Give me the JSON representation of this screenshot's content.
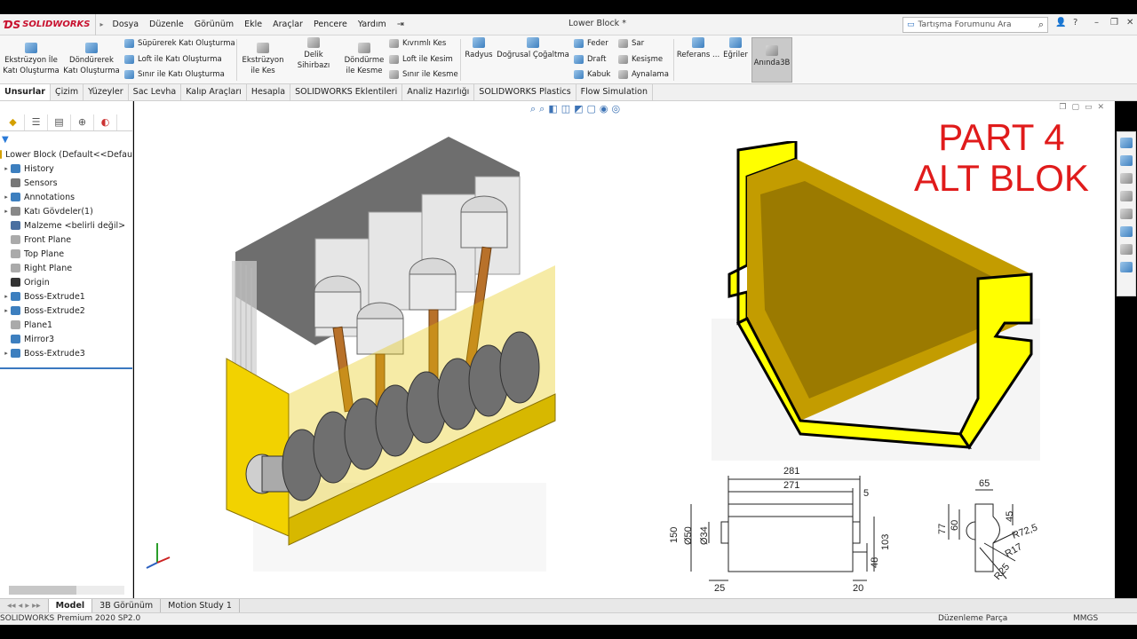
{
  "app": {
    "brand": "SOLIDWORKS",
    "document_title": "Lower Block *",
    "menu": [
      "Dosya",
      "Düzenle",
      "Görünüm",
      "Ekle",
      "Araçlar",
      "Pencere",
      "Yardım"
    ],
    "search_placeholder": "Tartışma Forumunu Ara"
  },
  "ribbon": {
    "extrude_boss": "Ekstrüzyon İle\nKatı Oluşturma",
    "revolve_boss": "Döndürerek\nKatı Oluşturma",
    "sweep_boss": "Süpürerek Katı Oluşturma",
    "loft_boss": "Loft ile Katı Oluşturma",
    "boundary_boss": "Sınır ile Katı Oluşturma",
    "extrude_cut": "Ekstrüzyon\nile Kes",
    "hole_wizard": "Delik Sihirbazı",
    "revolve_cut": "Döndürme\nile Kesme",
    "sweep_cut": "Kıvrımlı Kes",
    "loft_cut": "Loft ile Kesim",
    "boundary_cut": "Sınır ile Kesme",
    "fillet": "Radyus",
    "linear_pattern": "Doğrusal Çoğaltma",
    "rib": "Feder",
    "draft": "Draft",
    "shell": "Kabuk",
    "wrap": "Sar",
    "intersect": "Kesişme",
    "mirror": "Aynalama",
    "reference": "Referans ...",
    "curves": "Eğriler",
    "instant3d": "Anında3B"
  },
  "tabs": [
    "Unsurlar",
    "Çizim",
    "Yüzeyler",
    "Sac Levha",
    "Kalıp Araçları",
    "Hesapla",
    "SOLIDWORKS Eklentileri",
    "Analiz Hazırlığı",
    "SOLIDWORKS Plastics",
    "Flow Simulation"
  ],
  "tree": {
    "items": [
      {
        "label": "Lower Block  (Default<<Defau",
        "icon": "part-icon",
        "expand": "",
        "indent": 0
      },
      {
        "label": "History",
        "icon": "history-icon",
        "expand": "▸",
        "indent": 1
      },
      {
        "label": "Sensors",
        "icon": "sensors-icon",
        "expand": "",
        "indent": 1
      },
      {
        "label": "Annotations",
        "icon": "annotations-icon",
        "expand": "▸",
        "indent": 1
      },
      {
        "label": "Katı Gövdeler(1)",
        "icon": "solid-bodies-icon",
        "expand": "▸",
        "indent": 1
      },
      {
        "label": "Malzeme <belirli değil>",
        "icon": "material-icon",
        "expand": "",
        "indent": 1
      },
      {
        "label": "Front Plane",
        "icon": "plane-icon",
        "expand": "",
        "indent": 1
      },
      {
        "label": "Top Plane",
        "icon": "plane-icon",
        "expand": "",
        "indent": 1
      },
      {
        "label": "Right Plane",
        "icon": "plane-icon",
        "expand": "",
        "indent": 1
      },
      {
        "label": "Origin",
        "icon": "origin-icon",
        "expand": "",
        "indent": 1
      },
      {
        "label": "Boss-Extrude1",
        "icon": "extrude-icon",
        "expand": "▸",
        "indent": 1
      },
      {
        "label": "Boss-Extrude2",
        "icon": "extrude-icon",
        "expand": "▸",
        "indent": 1
      },
      {
        "label": "Plane1",
        "icon": "plane-icon",
        "expand": "",
        "indent": 1
      },
      {
        "label": "Mirror3",
        "icon": "mirror-icon",
        "expand": "",
        "indent": 1
      },
      {
        "label": "Boss-Extrude3",
        "icon": "extrude-icon",
        "expand": "▸",
        "indent": 1
      }
    ]
  },
  "graphics": {
    "title_line1": "PART 4",
    "title_line2": "ALT BLOK",
    "drawing": {
      "front": {
        "d281": "281",
        "d271": "271",
        "d5": "5",
        "d150": "150",
        "d50": "Ø50",
        "d34": "Ø34",
        "d103": "103",
        "d48": "48",
        "d25": "25",
        "d20": "20"
      },
      "side": {
        "d65": "65",
        "d77": "77",
        "d60": "60",
        "d45": "45",
        "r725": "R72,5",
        "r17": "R17",
        "r25": "R25"
      }
    }
  },
  "bottom_tabs": [
    "Model",
    "3B Görünüm",
    "Motion Study 1"
  ],
  "status": {
    "product": "SOLIDWORKS Premium 2020 SP2.0",
    "mode": "Düzenleme Parça",
    "units": "MMGS"
  },
  "colors": {
    "accent_red": "#e01b1b",
    "yellow_body": "#ffff00",
    "gold": "#c9a400"
  }
}
